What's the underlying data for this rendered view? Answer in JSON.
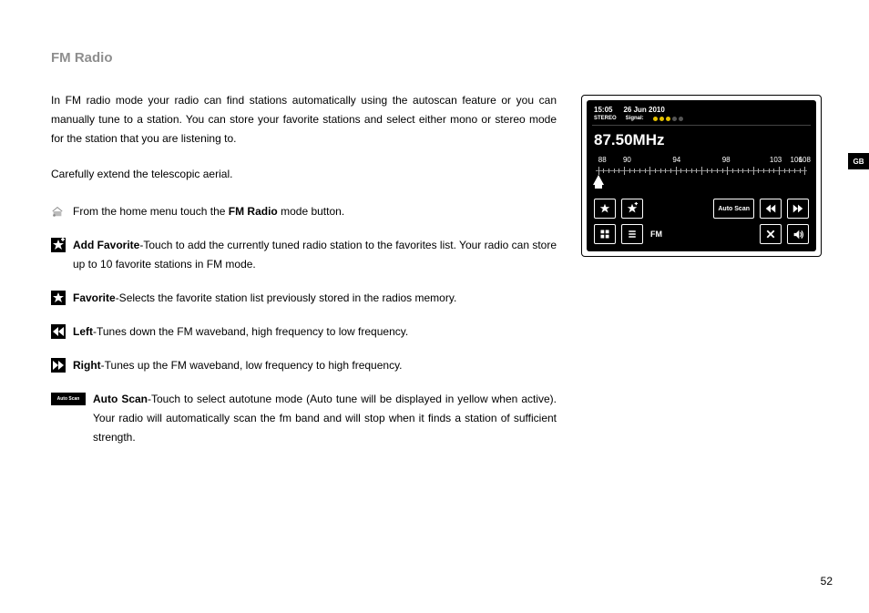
{
  "pageTitle": "FM Radio",
  "gbTab": "GB",
  "pageNumber": "52",
  "intro": {
    "p1": "In FM radio mode your radio can find stations automatically using the autoscan feature or you can manually tune to a station. You can store your favorite stations and select either mono or stereo mode for the station that you are listening to.",
    "p2": "Carefully extend the telescopic aerial."
  },
  "items": {
    "home": {
      "pre": "From the home menu touch the ",
      "bold": "FM Radio",
      "post": " mode button."
    },
    "addfav": {
      "lead": "Add Favorite",
      "rest": "-Touch to add the currently tuned radio station to the favorites list. Your radio can store up to 10 favorite stations in FM mode."
    },
    "fav": {
      "lead": "Favorite",
      "rest": "-Selects the favorite station list previously stored in the radios memory."
    },
    "left": {
      "lead": "Left",
      "rest": "-Tunes down the FM waveband, high frequency to low frequency."
    },
    "right": {
      "lead": "Right",
      "rest": "-Tunes up the FM waveband, low frequency to high frequency."
    },
    "auto": {
      "lead": "Auto Scan",
      "rest": "-Touch to select autotune mode (Auto tune will be displayed in yellow when active). Your radio will automatically scan the fm band and will stop when it finds a station of sufficient strength.",
      "btnLabel": "Auto Scan"
    }
  },
  "device": {
    "time": "15:05",
    "date": "26 Jun 2010",
    "stereo": "STEREO",
    "signalLabel": "Signal:",
    "signalLevel": 3,
    "frequency": "87.50MHz",
    "dialLabels": [
      "88",
      "90",
      "94",
      "98",
      "103",
      "106",
      "108"
    ],
    "dialPositions": [
      2,
      14,
      38,
      62,
      86,
      96,
      100
    ],
    "pointerPos": 0,
    "autoScanLabel": "Auto Scan",
    "modeLabel": "FM"
  }
}
